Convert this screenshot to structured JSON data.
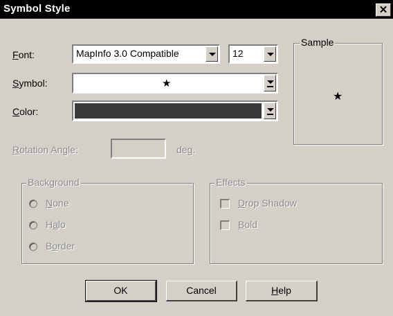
{
  "window": {
    "title": "Symbol Style",
    "close_glyph": "✕"
  },
  "form": {
    "font": {
      "label_first": "F",
      "label_rest": "ont:",
      "value": "MapInfo 3.0 Compatible",
      "size": "12"
    },
    "symbol": {
      "label_first": "S",
      "label_rest": "ymbol:",
      "glyph": "★"
    },
    "color": {
      "label_first": "C",
      "label_rest": "olor:",
      "value_hex": "#3a3a3a"
    },
    "rotation": {
      "label_first": "R",
      "label_rest": "otation Angle:",
      "value": "",
      "unit": "deg."
    }
  },
  "sample": {
    "label": "Sample",
    "glyph": "★"
  },
  "background": {
    "label": "Background",
    "options": [
      {
        "first": "N",
        "rest": "one",
        "prefix": ""
      },
      {
        "first": "a",
        "rest": "lo",
        "prefix": "H"
      },
      {
        "first": "o",
        "rest": "rder",
        "prefix": "B"
      }
    ]
  },
  "effects": {
    "label": "Effects",
    "options": [
      {
        "first": "D",
        "rest": "rop Shadow"
      },
      {
        "first": "B",
        "rest": "old"
      }
    ]
  },
  "buttons": {
    "ok": "OK",
    "cancel": "Cancel",
    "help_first": "H",
    "help_rest": "elp"
  },
  "colors": {
    "titlebar": "#000000",
    "dialog_bg": "#d4d0c8",
    "disabled_text": "#8a8a8a"
  }
}
